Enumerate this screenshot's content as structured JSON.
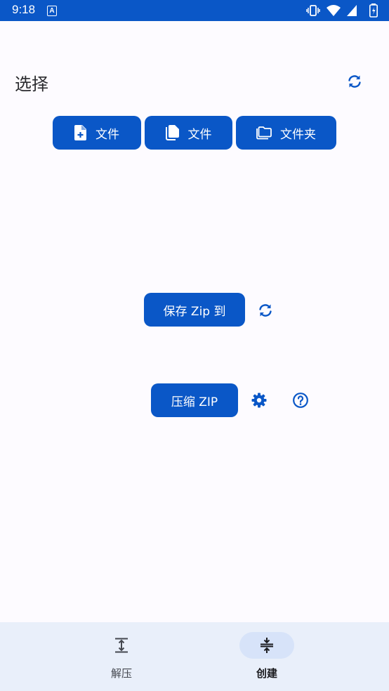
{
  "status_bar": {
    "time": "9:18",
    "notification_icon": "A",
    "icons": [
      "vibrate-icon",
      "wifi-icon",
      "signal-icon",
      "battery-icon"
    ],
    "color": "#0a57c7"
  },
  "header": {
    "title": "选择",
    "refresh_icon": "refresh-icon"
  },
  "select_buttons": [
    {
      "label": "文件",
      "icon": "file-add-icon"
    },
    {
      "label": "文件",
      "icon": "files-icon"
    },
    {
      "label": "文件夹",
      "icon": "folder-icon"
    }
  ],
  "save": {
    "label": "保存 Zip 到",
    "refresh_icon": "refresh-icon"
  },
  "compress": {
    "label": "压缩 ZIP",
    "settings_icon": "gear-icon",
    "help_icon": "help-icon"
  },
  "bottom_nav": {
    "items": [
      {
        "label": "解压",
        "icon": "extract-icon",
        "active": false
      },
      {
        "label": "创建",
        "icon": "compress-icon",
        "active": true
      }
    ]
  },
  "colors": {
    "primary": "#0a57c7",
    "background": "#fdfbff",
    "nav_background": "#e9effa",
    "nav_indicator": "#d7e3f9"
  }
}
